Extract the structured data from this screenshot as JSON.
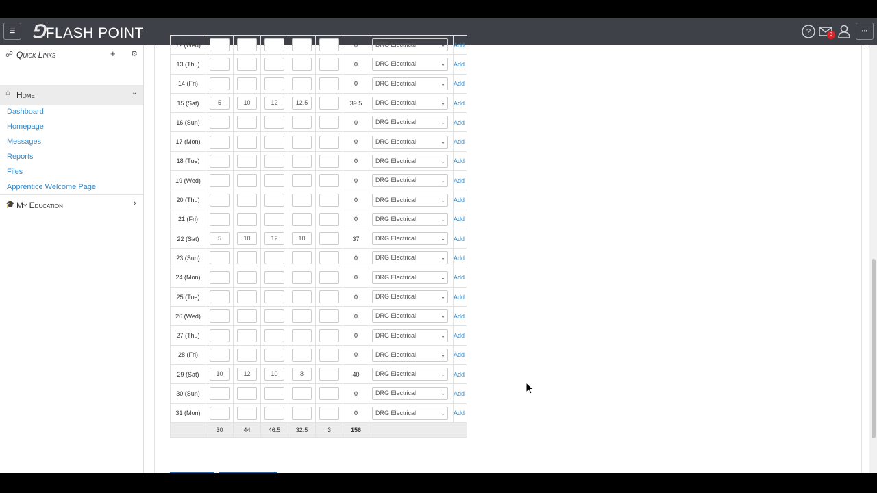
{
  "app": {
    "logo_mark": "⅁",
    "logo_text": "FLASH POINT"
  },
  "topbar": {
    "menu_icon": "hamburger-icon",
    "help_icon": "help-circle-icon",
    "mail_icon": "envelope-icon",
    "mail_badge": "3",
    "user_icon": "user-icon",
    "more_icon": "ellipsis-icon",
    "more_label": "•••",
    "menu_label": "≡"
  },
  "sidebar": {
    "quick_links": "Quick Links",
    "home": "Home",
    "links": [
      "Dashboard",
      "Homepage",
      "Messages",
      "Reports",
      "Files",
      "Apprentice Welcome Page"
    ],
    "my_education": "My Education"
  },
  "timesheet": {
    "rows": [
      {
        "day": "12 (Wed)",
        "v": [
          "",
          "",
          "",
          "",
          ""
        ],
        "total": "0",
        "employer": "DRG Electrical",
        "action": "Add"
      },
      {
        "day": "13 (Thu)",
        "v": [
          "",
          "",
          "",
          "",
          ""
        ],
        "total": "0",
        "employer": "DRG Electrical",
        "action": "Add"
      },
      {
        "day": "14 (Fri)",
        "v": [
          "",
          "",
          "",
          "",
          ""
        ],
        "total": "0",
        "employer": "DRG Electrical",
        "action": "Add"
      },
      {
        "day": "15 (Sat)",
        "v": [
          "5",
          "10",
          "12",
          "12.5",
          ""
        ],
        "total": "39.5",
        "employer": "DRG Electrical",
        "action": "Add"
      },
      {
        "day": "16 (Sun)",
        "v": [
          "",
          "",
          "",
          "",
          ""
        ],
        "total": "0",
        "employer": "DRG Electrical",
        "action": "Add"
      },
      {
        "day": "17 (Mon)",
        "v": [
          "",
          "",
          "",
          "",
          ""
        ],
        "total": "0",
        "employer": "DRG Electrical",
        "action": "Add"
      },
      {
        "day": "18 (Tue)",
        "v": [
          "",
          "",
          "",
          "",
          ""
        ],
        "total": "0",
        "employer": "DRG Electrical",
        "action": "Add"
      },
      {
        "day": "19 (Wed)",
        "v": [
          "",
          "",
          "",
          "",
          ""
        ],
        "total": "0",
        "employer": "DRG Electrical",
        "action": "Add"
      },
      {
        "day": "20 (Thu)",
        "v": [
          "",
          "",
          "",
          "",
          ""
        ],
        "total": "0",
        "employer": "DRG Electrical",
        "action": "Add"
      },
      {
        "day": "21 (Fri)",
        "v": [
          "",
          "",
          "",
          "",
          ""
        ],
        "total": "0",
        "employer": "DRG Electrical",
        "action": "Add"
      },
      {
        "day": "22 (Sat)",
        "v": [
          "5",
          "10",
          "12",
          "10",
          ""
        ],
        "total": "37",
        "employer": "DRG Electrical",
        "action": "Add"
      },
      {
        "day": "23 (Sun)",
        "v": [
          "",
          "",
          "",
          "",
          ""
        ],
        "total": "0",
        "employer": "DRG Electrical",
        "action": "Add"
      },
      {
        "day": "24 (Mon)",
        "v": [
          "",
          "",
          "",
          "",
          ""
        ],
        "total": "0",
        "employer": "DRG Electrical",
        "action": "Add"
      },
      {
        "day": "25 (Tue)",
        "v": [
          "",
          "",
          "",
          "",
          ""
        ],
        "total": "0",
        "employer": "DRG Electrical",
        "action": "Add"
      },
      {
        "day": "26 (Wed)",
        "v": [
          "",
          "",
          "",
          "",
          ""
        ],
        "total": "0",
        "employer": "DRG Electrical",
        "action": "Add"
      },
      {
        "day": "27 (Thu)",
        "v": [
          "",
          "",
          "",
          "",
          ""
        ],
        "total": "0",
        "employer": "DRG Electrical",
        "action": "Add"
      },
      {
        "day": "28 (Fri)",
        "v": [
          "",
          "",
          "",
          "",
          ""
        ],
        "total": "0",
        "employer": "DRG Electrical",
        "action": "Add"
      },
      {
        "day": "29 (Sat)",
        "v": [
          "10",
          "12",
          "10",
          "8",
          ""
        ],
        "total": "40",
        "employer": "DRG Electrical",
        "action": "Add"
      },
      {
        "day": "30 (Sun)",
        "v": [
          "",
          "",
          "",
          "",
          ""
        ],
        "total": "0",
        "employer": "DRG Electrical",
        "action": "Add"
      },
      {
        "day": "31 (Mon)",
        "v": [
          "",
          "",
          "",
          "",
          ""
        ],
        "total": "0",
        "employer": "DRG Electrical",
        "action": "Add"
      }
    ],
    "totals": [
      "30",
      "44",
      "46.5",
      "32.5",
      "3"
    ],
    "grand_total": "156"
  },
  "colors": {
    "topbar": "#3e4147",
    "link": "#3a8bc8",
    "badge": "#d9262b"
  }
}
